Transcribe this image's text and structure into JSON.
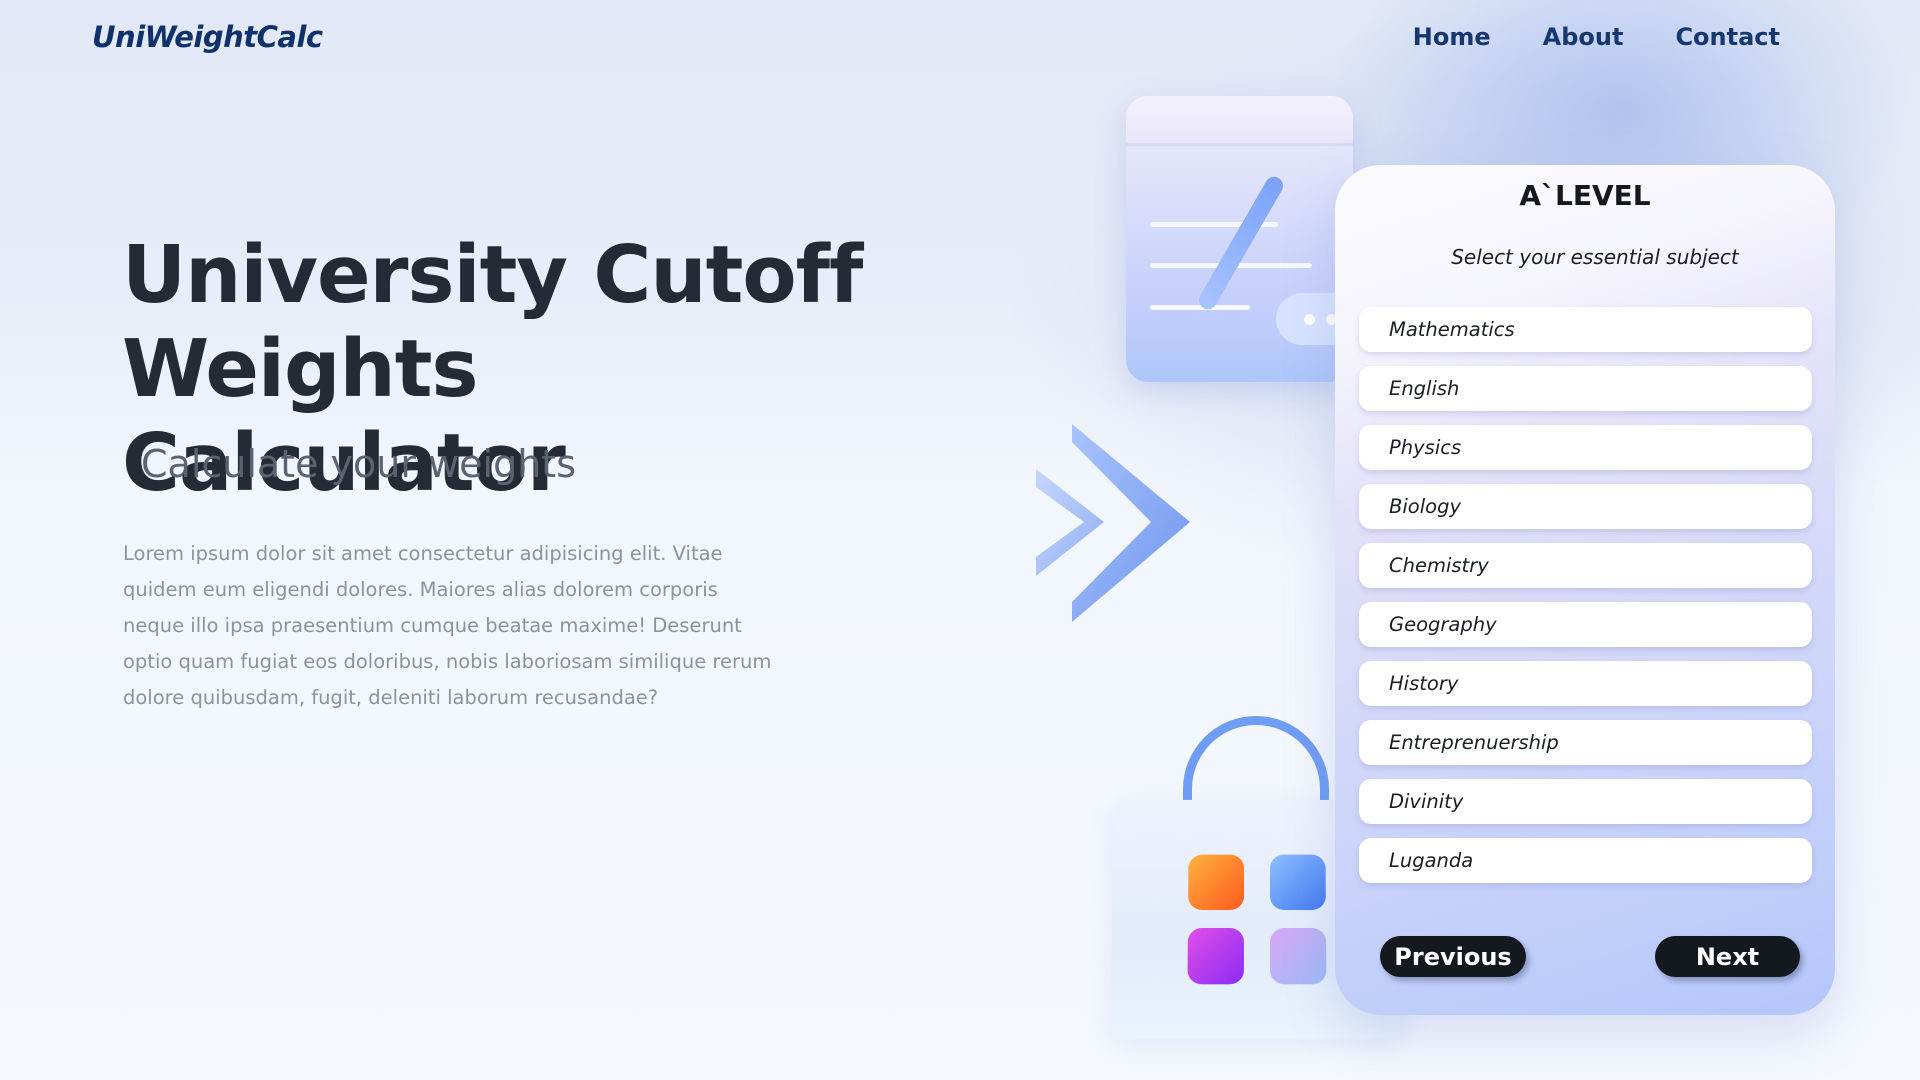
{
  "nav": {
    "logo": "UniWeightCalc",
    "links": [
      "Home",
      "About",
      "Contact"
    ]
  },
  "hero": {
    "title": "University Cutoff Weights Calculator",
    "subtitle": "Calculate your weights",
    "body": "Lorem ipsum dolor sit amet consectetur adipisicing elit. Vitae quidem eum eligendi dolores. Maiores alias  dolorem corporis neque illo ipsa praesentium cumque beatae maxime! Deserunt optio quam fugiat eos doloribus, nobis laboriosam similique rerum dolore quibusdam, fugit, deleniti laborum recusandae?"
  },
  "card": {
    "title": "A`LEVEL",
    "subtitle": "Select your essential subject",
    "subjects": [
      "Mathematics",
      "English",
      "Physics",
      "Biology",
      "Chemistry",
      "Geography",
      "History",
      "Entreprenuership",
      "Divinity",
      "Luganda"
    ],
    "previous_label": "Previous",
    "next_label": "Next"
  },
  "colors": {
    "brand": "#10326a",
    "nav_link": "#16386f",
    "button_bg": "#14181f",
    "accent_blue": "#6f9cf5"
  },
  "illustrations": {
    "document_icon": "document-pen-icon",
    "arrow_icon": "double-chevron-right-icon",
    "bag_icon": "shopping-bag-apps-icon"
  }
}
